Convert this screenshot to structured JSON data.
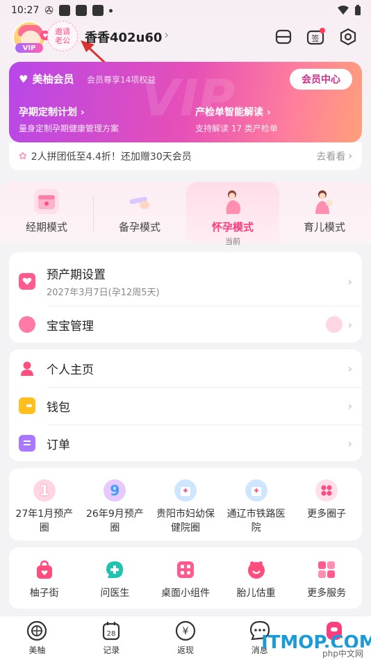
{
  "status_bar": {
    "time": "10:27"
  },
  "profile": {
    "vip_tag": "VIP",
    "invite_line1": "邀请",
    "invite_line2": "老公",
    "username": "香香402u60"
  },
  "member_card": {
    "title": "美柚会员",
    "subtitle": "会员尊享14项权益",
    "center_button": "会员中心",
    "feature1_title": "孕期定制计划",
    "feature1_sub": "量身定制孕期健康管理方案",
    "feature2_title": "产检单智能解读",
    "feature2_sub": "支持解读 17 类产检单",
    "bg_text": "VIP"
  },
  "promo": {
    "text": "2人拼团低至4.4折！还加赠30天会员",
    "action": "去看看"
  },
  "modes": [
    {
      "label": "经期模式"
    },
    {
      "label": "备孕模式"
    },
    {
      "label": "怀孕模式",
      "sub": "当前"
    },
    {
      "label": "育儿模式"
    }
  ],
  "pregnancy_card": {
    "due_title": "预产期设置",
    "due_sub": "2027年3月7日(孕12周5天)",
    "baby_title": "宝宝管理"
  },
  "menu": [
    {
      "label": "个人主页"
    },
    {
      "label": "钱包"
    },
    {
      "label": "订单"
    }
  ],
  "circles": [
    {
      "line1": "27年1月预产",
      "line2": "圈"
    },
    {
      "line1": "26年9月预产",
      "line2": "圈"
    },
    {
      "line1": "贵阳市妇幼保",
      "line2": "健院圈"
    },
    {
      "line1": "通辽市铁路医",
      "line2": "院"
    },
    {
      "line1": "更多圈子",
      "line2": ""
    }
  ],
  "services": [
    {
      "label": "柚子街"
    },
    {
      "label": "问医生"
    },
    {
      "label": "桌面小组件"
    },
    {
      "label": "胎儿估重"
    },
    {
      "label": "更多服务"
    }
  ],
  "bottom_nav": [
    {
      "label": "美柚"
    },
    {
      "label": "记录",
      "icon_text": "28"
    },
    {
      "label": "返现"
    },
    {
      "label": "消息"
    },
    {
      "label": ""
    }
  ],
  "watermark": {
    "main": "ITMOP.COM",
    "sub": "php中文网"
  },
  "colors": {
    "accent": "#ff3c7e",
    "member_start": "#b847e8",
    "member_end": "#ffa07a"
  }
}
